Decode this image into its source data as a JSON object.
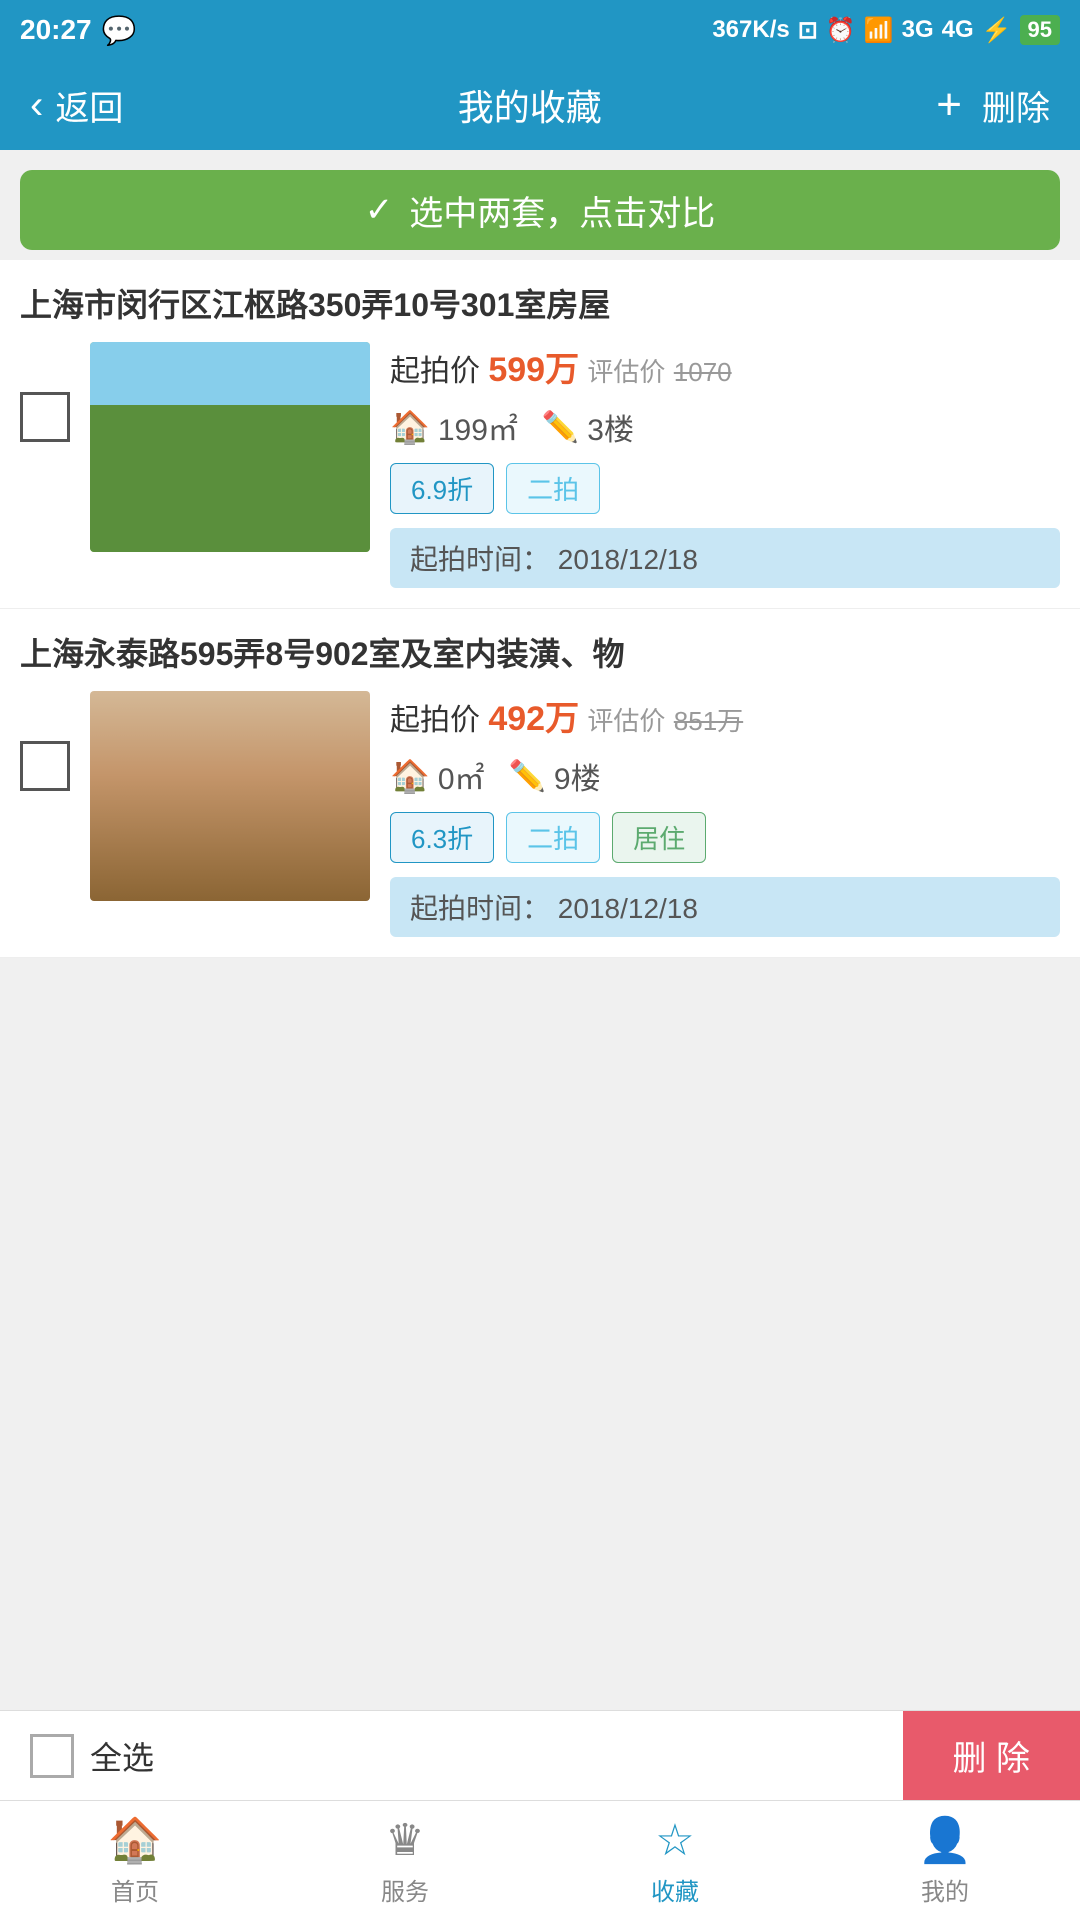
{
  "statusBar": {
    "time": "20:27",
    "networkSpeed": "367K/s",
    "battery": "95",
    "batteryColor": "#4caf50"
  },
  "header": {
    "backLabel": "返回",
    "title": "我的收藏",
    "addIcon": "+",
    "deleteLabel": "删除"
  },
  "compareBanner": {
    "checkIcon": "✓",
    "label": "选中两套，点击对比"
  },
  "listings": [
    {
      "id": 1,
      "title": "上海市闵行区江枢路350弄10号301室房屋",
      "startPriceLabel": "起拍价",
      "startPrice": "599万",
      "estimateLabel": "评估价",
      "estimatePrice": "1070",
      "area": "199㎡",
      "floor": "3楼",
      "tags": [
        {
          "text": "6.9折",
          "type": "blue"
        },
        {
          "text": "二拍",
          "type": "light-blue"
        }
      ],
      "dateLabel": "起拍时间：",
      "date": "2018/12/18",
      "imageType": "garden"
    },
    {
      "id": 2,
      "title": "上海永泰路595弄8号902室及室内装潢、物",
      "startPriceLabel": "起拍价",
      "startPrice": "492万",
      "estimateLabel": "评估价",
      "estimatePrice": "851万",
      "area": "0㎡",
      "floor": "9楼",
      "tags": [
        {
          "text": "6.3折",
          "type": "blue"
        },
        {
          "text": "二拍",
          "type": "light-blue"
        },
        {
          "text": "居住",
          "type": "green"
        }
      ],
      "dateLabel": "起拍时间：",
      "date": "2018/12/18",
      "imageType": "indoor"
    }
  ],
  "bottomBar": {
    "selectAllLabel": "全选",
    "deleteLabel": "删 除"
  },
  "tabBar": {
    "tabs": [
      {
        "label": "首页",
        "icon": "🏠",
        "active": false
      },
      {
        "label": "服务",
        "icon": "👑",
        "active": false
      },
      {
        "label": "收藏",
        "icon": "☆",
        "active": true
      },
      {
        "label": "我的",
        "icon": "👤",
        "active": false
      }
    ]
  }
}
